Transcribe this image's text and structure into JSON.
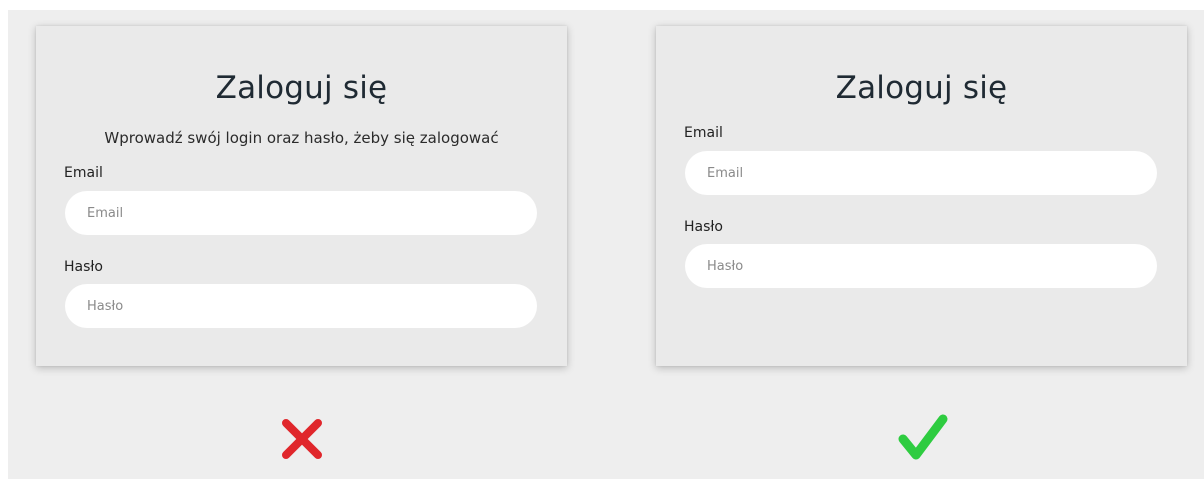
{
  "bad_example": {
    "title": "Zaloguj się",
    "subtitle": "Wprowadź swój login oraz hasło, żeby się zalogować",
    "email_label": "Email",
    "email_placeholder": "Email",
    "password_label": "Hasło",
    "password_placeholder": "Hasło",
    "verdict_icon": "red-x-icon",
    "verdict_color": "#e0262b"
  },
  "good_example": {
    "title": "Zaloguj się",
    "email_label": "Email",
    "email_placeholder": "Email",
    "password_label": "Hasło",
    "password_placeholder": "Hasło",
    "verdict_icon": "green-checkmark-icon",
    "verdict_color": "#2ecc40"
  }
}
